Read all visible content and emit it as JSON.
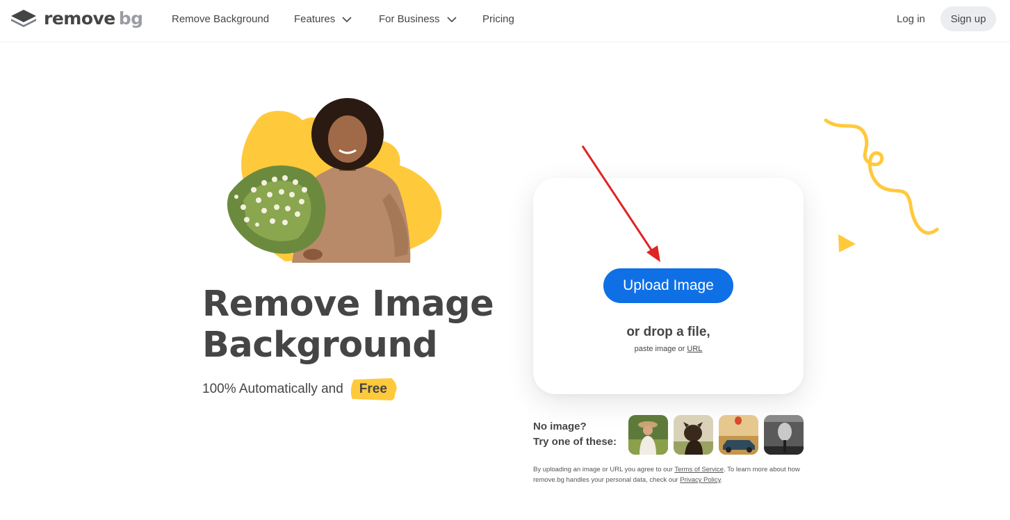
{
  "header": {
    "logo": {
      "word1": "remove",
      "word2": "bg"
    },
    "nav": [
      {
        "label": "Remove Background",
        "has_dropdown": false
      },
      {
        "label": "Features",
        "has_dropdown": true
      },
      {
        "label": "For Business",
        "has_dropdown": true
      },
      {
        "label": "Pricing",
        "has_dropdown": false
      }
    ],
    "login_label": "Log in",
    "signup_label": "Sign up"
  },
  "hero": {
    "title_line1": "Remove Image",
    "title_line2": "Background",
    "subtitle": "100% Automatically and",
    "badge": "Free"
  },
  "upload": {
    "button_label": "Upload Image",
    "drop_text": "or drop a file,",
    "paste_prefix": "paste image or",
    "url_link": "URL"
  },
  "samples": {
    "line1": "No image?",
    "line2": "Try one of these:",
    "thumbs": [
      "woman-with-hat",
      "dog",
      "car-with-balloon",
      "microphone"
    ]
  },
  "legal": {
    "part1": "By uploading an image or URL you agree to our",
    "terms_link": "Terms of Service",
    "part2": ". To learn more about how remove.bg handles your personal data, check our",
    "privacy_link": "Privacy Policy",
    "part3": "."
  },
  "colors": {
    "accent_blue": "#0f70e6",
    "yellow": "#ffc93c",
    "text": "#454545",
    "arrow_red": "#e02424"
  }
}
